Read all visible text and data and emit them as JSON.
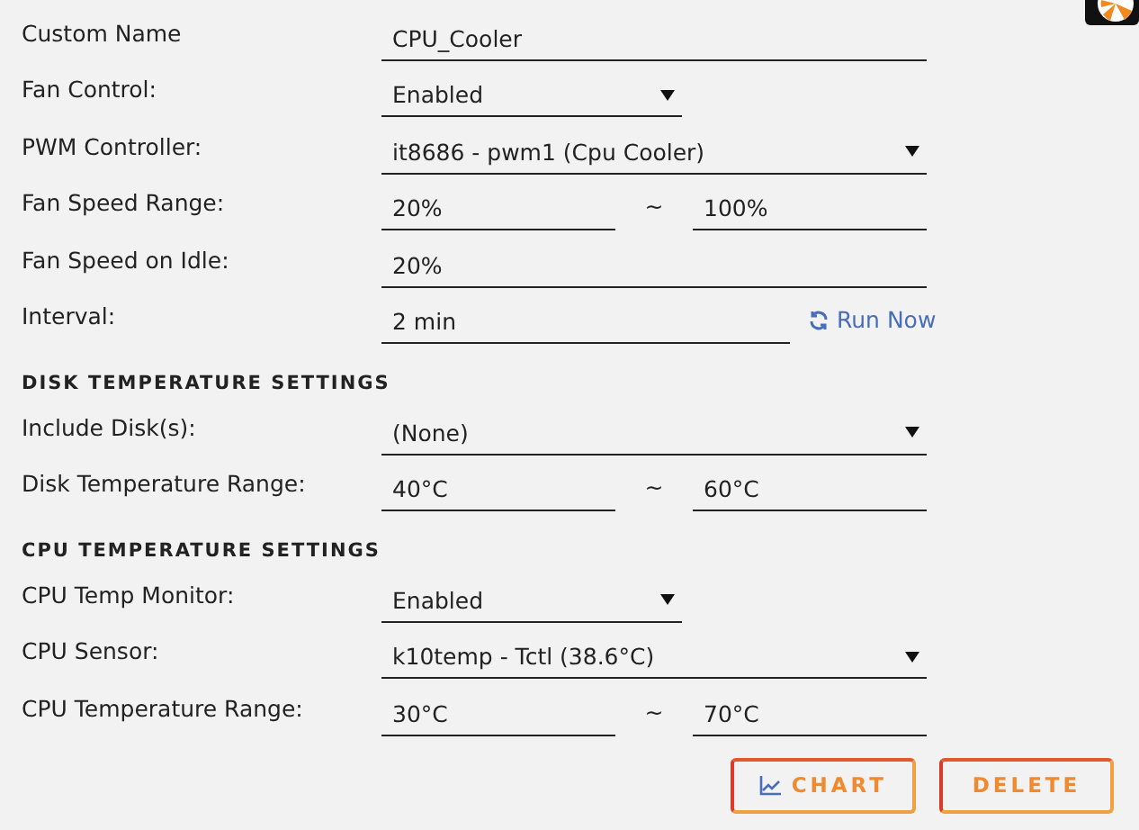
{
  "sections": [
    {
      "rows": [
        {
          "kind": "text",
          "label": "Custom Name",
          "value": "CPU_Cooler"
        },
        {
          "kind": "select-short",
          "label": "Fan Control:",
          "value": "Enabled"
        },
        {
          "kind": "select",
          "label": "PWM Controller:",
          "value": "it8686 - pwm1  (Cpu Cooler)"
        },
        {
          "kind": "range",
          "label": "Fan Speed Range:",
          "value": "20%",
          "separator": "~",
          "value_to": "100%"
        },
        {
          "kind": "text",
          "label": "Fan Speed on Idle:",
          "value": "20%"
        },
        {
          "kind": "action",
          "label": "Interval:",
          "value": "2 min",
          "action": "Run Now"
        }
      ]
    },
    {
      "heading": "DISK TEMPERATURE SETTINGS",
      "rows": [
        {
          "kind": "select",
          "label": "Include Disk(s):",
          "value": "(None)"
        },
        {
          "kind": "range",
          "label": "Disk Temperature Range:",
          "value": "40°C",
          "separator": "~",
          "value_to": "60°C"
        }
      ]
    },
    {
      "heading": "CPU TEMPERATURE SETTINGS",
      "rows": [
        {
          "kind": "select-short",
          "label": "CPU Temp Monitor:",
          "value": "Enabled"
        },
        {
          "kind": "select",
          "label": "CPU Sensor:",
          "value": "k10temp - Tctl (38.6°C)"
        },
        {
          "kind": "range",
          "label": "CPU Temperature Range:",
          "value": "30°C",
          "separator": "~",
          "value_to": "70°C"
        }
      ]
    }
  ],
  "buttons": [
    {
      "kind": "chart",
      "label": "CHART"
    },
    {
      "kind": "delete",
      "label": "DELETE"
    }
  ]
}
